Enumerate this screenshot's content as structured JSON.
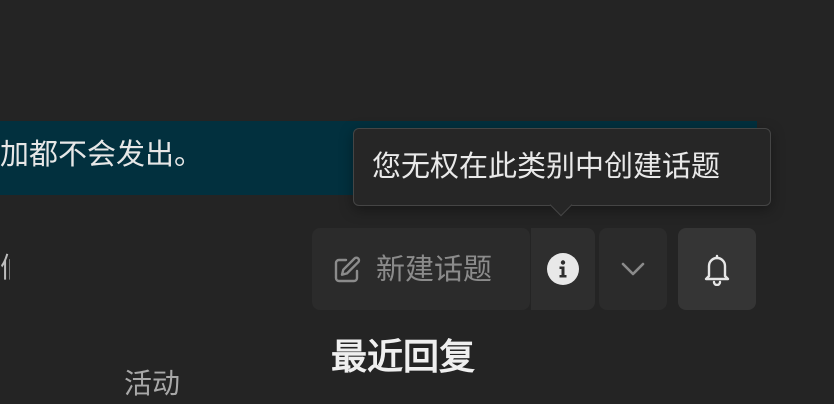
{
  "banner": {
    "text": "加都不会发出。"
  },
  "left_fragment": {
    "text": "们"
  },
  "tooltip": {
    "text": "您无权在此类别中创建话题"
  },
  "toolbar": {
    "new_topic_label": "新建话题",
    "new_topic_icon": "pencil-square-icon",
    "info_icon": "info-circle-icon",
    "dropdown_icon": "chevron-down-icon",
    "bell_icon": "bell-icon"
  },
  "main": {
    "recent_title": "最近回复"
  },
  "columns": {
    "activity_label": "活动"
  },
  "colors": {
    "background": "#242424",
    "banner": "#02303e",
    "tooltip_bg": "#262626",
    "button_bg": "#2b2b2b",
    "bell_button_bg": "#353535",
    "text_primary": "#efefef",
    "text_muted": "#8b8b8b"
  }
}
